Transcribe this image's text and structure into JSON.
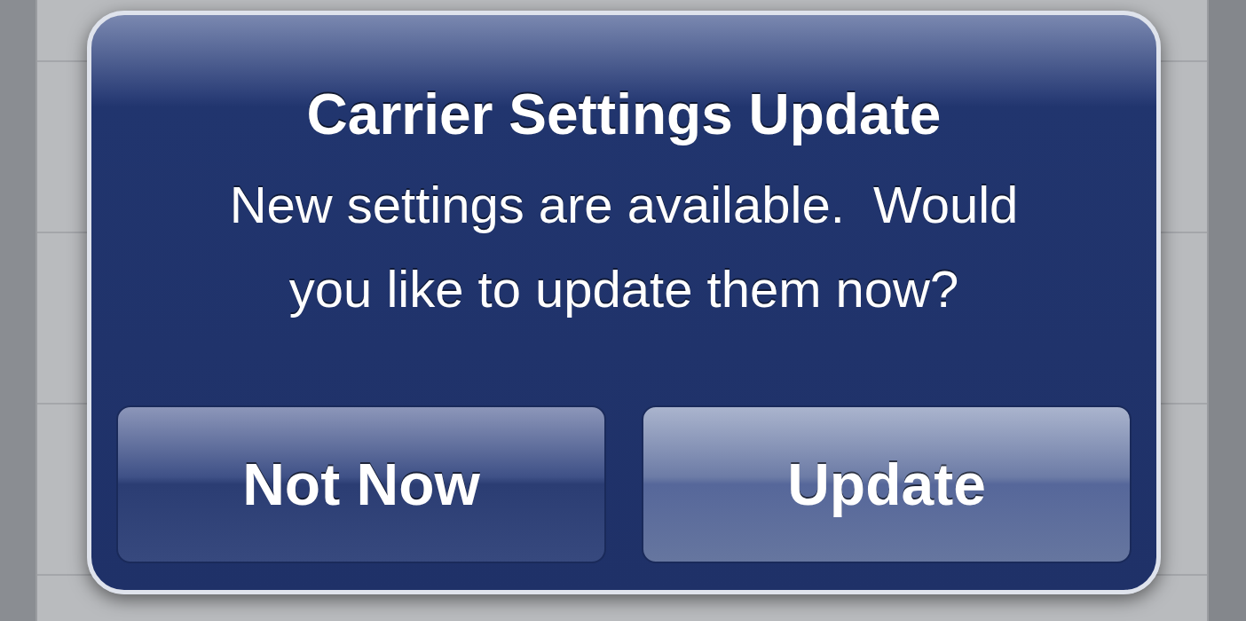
{
  "alert": {
    "title": "Carrier Settings Update",
    "message_lines": [
      "New settings are available.  Would",
      "you like to update them now?"
    ],
    "buttons": [
      {
        "label": "Not Now",
        "kind": "cancel"
      },
      {
        "label": "Update",
        "kind": "default"
      }
    ]
  }
}
